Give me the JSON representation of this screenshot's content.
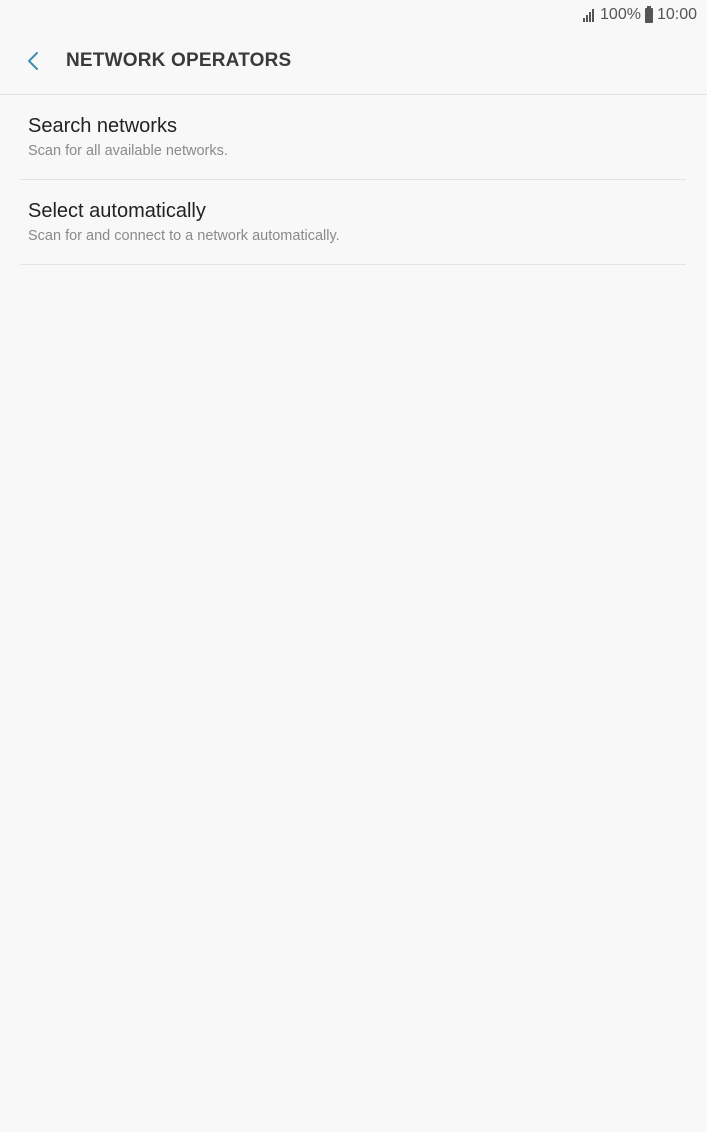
{
  "status_bar": {
    "signal_icon": "signal-bars-icon",
    "battery_percent": "100%",
    "battery_icon": "battery-full-icon",
    "time": "10:00"
  },
  "header": {
    "back_icon": "chevron-left-icon",
    "title": "NETWORK OPERATORS"
  },
  "colors": {
    "accent": "#3e8fb0",
    "background": "#f8f8f8",
    "divider": "#e4e4e4",
    "title_text": "#3a3a3a",
    "primary_text": "#222222",
    "secondary_text": "#8a8a8a"
  },
  "items": [
    {
      "title": "Search networks",
      "subtitle": "Scan for all available networks."
    },
    {
      "title": "Select automatically",
      "subtitle": "Scan for and connect to a network automatically."
    }
  ]
}
